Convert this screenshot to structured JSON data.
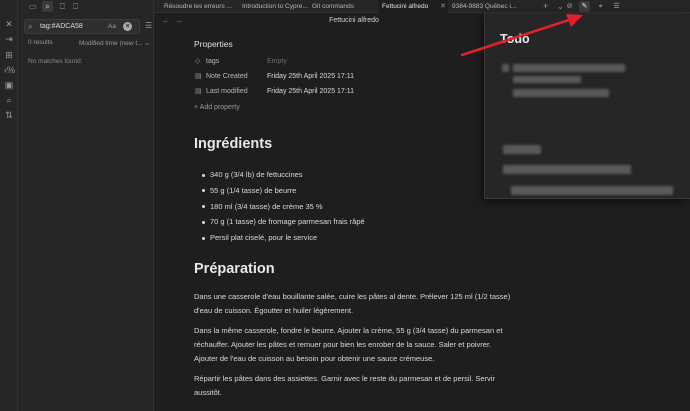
{
  "ribbon": {
    "icons": [
      "shuffle-icon",
      "open-folder-icon",
      "graph-icon",
      "command-icon",
      "template-icon",
      "search-icon",
      "sort-icon"
    ]
  },
  "sidebar": {
    "top_icons": [
      "folder-icon",
      "search-icon",
      "bookmark-icon",
      "bookmark-alt-icon"
    ],
    "search": {
      "value": "tag:#ADCA58",
      "match_case_label": "Aa"
    },
    "results_label": "0 results",
    "sort_label": "Modified time (new t...",
    "no_matches": "No matches found."
  },
  "tabs": [
    {
      "label": "Résoudre les erreurs ...",
      "active": false
    },
    {
      "label": "Introduction to Cypre...",
      "active": false
    },
    {
      "label": "Git commands",
      "active": false
    },
    {
      "label": "Fettucini alfredo",
      "active": true
    },
    {
      "label": "9384-9883 Québec i...",
      "active": false
    }
  ],
  "view": {
    "title": "Fettucini alfredo"
  },
  "properties": {
    "title": "Properties",
    "rows": [
      {
        "icon": "tag-icon",
        "key": "tags",
        "value": "Empty",
        "empty": true
      },
      {
        "icon": "calendar-icon",
        "key": "Note Created",
        "value": "Friday 25th April 2025 17:11",
        "empty": false
      },
      {
        "icon": "calendar-icon",
        "key": "Last modified",
        "value": "Friday 25th April 2025 17:11",
        "empty": false
      }
    ],
    "add_label": "+ Add property"
  },
  "content": {
    "ingredients_heading": "Ingrédients",
    "ingredients": [
      "340 g (3/4 lb) de fettuccines",
      "55 g (1/4 tasse) de beurre",
      "180 ml (3/4 tasse) de crème 35 %",
      "70 g (1 tasse) de fromage parmesan frais râpé",
      "Persil plat ciselé, pour le service"
    ],
    "preparation_heading": "Préparation",
    "paragraphs": [
      "Dans une casserole d'eau bouillante salée, cuire les pâtes al dente. Prélever 125 ml (1/2 tasse) d'eau de cuisson. Égoutter et huiler légèrement.",
      "Dans la même casserole, fondre le beurre. Ajouter la crème, 55 g (3/4 tasse) du parmesan et réchauffer. Ajouter les pâtes et remuer pour bien les enrober de la sauce. Saler et poivrer. Ajouter de l'eau de cuisson au besoin pour obtenir une sauce crémeuse.",
      "Répartir les pâtes dans des assiettes. Garnir avec le reste du parmesan et de persil. Servir aussitôt."
    ]
  },
  "todo": {
    "title": "Todo"
  },
  "colors": {
    "annotation_arrow": "#e0212c",
    "background": "#1e1e1e",
    "sidebar": "#262626"
  }
}
